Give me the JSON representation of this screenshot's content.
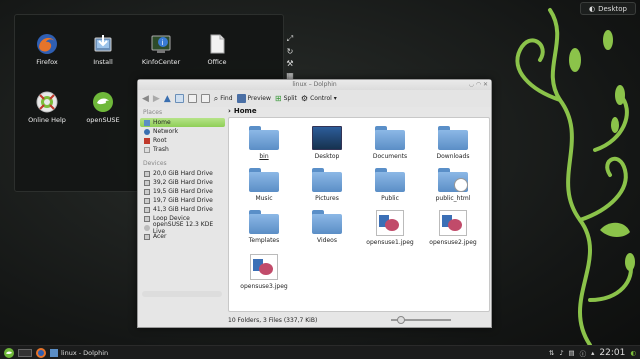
{
  "desktop": {
    "toolbox_label": "Desktop",
    "icons": [
      {
        "label": "Firefox"
      },
      {
        "label": "Install"
      },
      {
        "label": "KinfoCenter"
      },
      {
        "label": "Office"
      },
      {
        "label": "Online Help"
      },
      {
        "label": "openSUSE"
      }
    ],
    "accent_green": "#7cbf3a"
  },
  "dolphin": {
    "title": "linux – Dolphin",
    "toolbar": {
      "find_label": "Find",
      "preview_label": "Preview",
      "split_label": "Split",
      "control_label": "Control"
    },
    "breadcrumb": {
      "current": "Home"
    },
    "places": {
      "places_header": "Places",
      "items": [
        "Home",
        "Network",
        "Root",
        "Trash"
      ],
      "devices_header": "Devices",
      "devices": [
        "20,0 GiB Hard Drive",
        "39,2 GiB Hard Drive",
        "19,5 GiB Hard Drive",
        "19,7 GiB Hard Drive",
        "41,3 GiB Hard Drive",
        "Loop Device",
        "openSUSE 12.3 KDE Live",
        "Acer"
      ]
    },
    "files": [
      {
        "name": "bin",
        "kind": "folder"
      },
      {
        "name": "Desktop",
        "kind": "desktop"
      },
      {
        "name": "Documents",
        "kind": "folder"
      },
      {
        "name": "Downloads",
        "kind": "folder"
      },
      {
        "name": "Music",
        "kind": "folder"
      },
      {
        "name": "Pictures",
        "kind": "folder"
      },
      {
        "name": "Public",
        "kind": "folder"
      },
      {
        "name": "public_html",
        "kind": "web"
      },
      {
        "name": "Templates",
        "kind": "folder"
      },
      {
        "name": "Videos",
        "kind": "folder"
      },
      {
        "name": "opensuse1.jpeg",
        "kind": "image"
      },
      {
        "name": "opensuse2.jpeg",
        "kind": "image"
      },
      {
        "name": "opensuse3.jpeg",
        "kind": "image"
      }
    ],
    "status_text": "10 Folders, 3 Files (337,7 KiB)"
  },
  "taskbar": {
    "task_label": "linux - Dolphin",
    "clock": "22:01"
  }
}
